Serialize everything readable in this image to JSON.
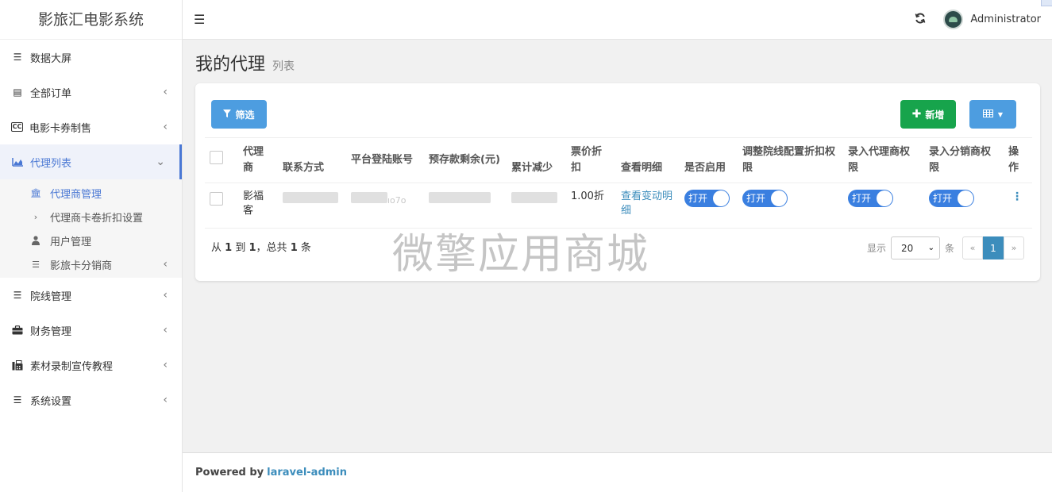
{
  "brand": "影旅汇电影系统",
  "header": {
    "user": "Administrator"
  },
  "sidebar": {
    "items": [
      {
        "label": "数据大屏",
        "icon": "bars-icon",
        "chevron": ""
      },
      {
        "label": "全部订单",
        "icon": "list-icon",
        "chevron": "‹"
      },
      {
        "label": "电影卡券制售",
        "icon": "cc-icon",
        "chevron": "‹"
      },
      {
        "label": "代理列表",
        "icon": "area-chart-icon",
        "chevron": "⌄"
      },
      {
        "label": "院线管理",
        "icon": "bars-icon",
        "chevron": "‹"
      },
      {
        "label": "财务管理",
        "icon": "briefcase-icon",
        "chevron": "‹"
      },
      {
        "label": "素材录制宣传教程",
        "icon": "fax-icon",
        "chevron": "‹"
      },
      {
        "label": "系统设置",
        "icon": "bars-icon",
        "chevron": "‹"
      }
    ],
    "sub_items": [
      {
        "label": "代理商管理",
        "icon": "bank-icon"
      },
      {
        "label": "代理商卡卷折扣设置",
        "icon": "angle-right-icon"
      },
      {
        "label": "用户管理",
        "icon": "user-icon"
      },
      {
        "label": "影旅卡分销商",
        "icon": "bars-icon",
        "chevron": "‹"
      }
    ]
  },
  "page": {
    "title": "我的代理",
    "subtitle": "列表"
  },
  "toolbar": {
    "filter": "筛选",
    "new": "新增"
  },
  "table": {
    "headers": [
      "代理商",
      "联系方式",
      "平台登陆账号",
      "预存款剩余(元)",
      "累计减少",
      "票价折扣",
      "查看明细",
      "是否启用",
      "调整院线配置折扣权限",
      "录入代理商权限",
      "录入分销商权限",
      "操作"
    ],
    "row": {
      "agent": "影福客",
      "discount": "1.00折",
      "detail_link": "查看变动明细",
      "switch_label": "打开",
      "account_suffix": "ıo7o"
    }
  },
  "pagination": {
    "summary_from": "从",
    "from": "1",
    "to_label": "到",
    "to": "1",
    "total_label": "，总共",
    "total": "1",
    "unit": "条",
    "show": "显示",
    "per_page": "20",
    "per_page_unit": "条",
    "prev": "«",
    "current": "1",
    "next": "»"
  },
  "watermark": "微擎应用商城",
  "footer": {
    "powered": "Powered by",
    "link": "laravel-admin"
  }
}
